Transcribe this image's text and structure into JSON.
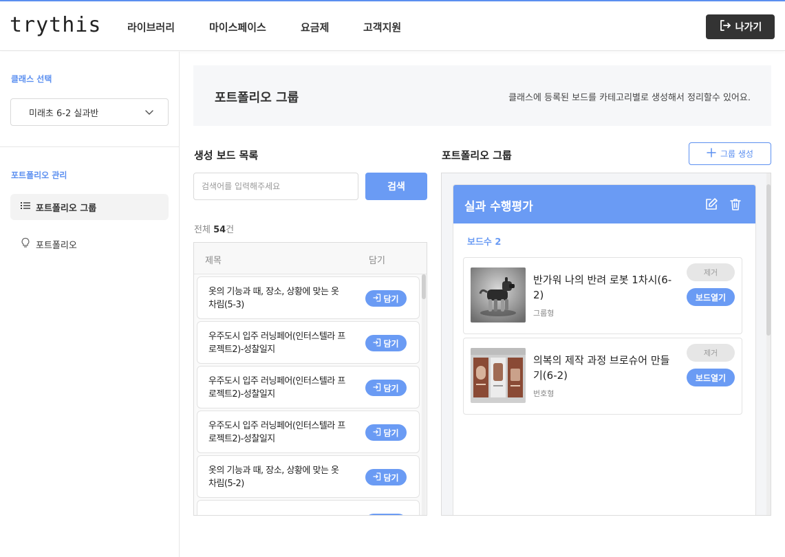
{
  "app": {
    "logo": "trythis",
    "accent": "#5b8ff0",
    "button_blue": "#6a9bf4"
  },
  "nav": {
    "items": [
      {
        "label": "라이브러리"
      },
      {
        "label": "마이스페이스"
      },
      {
        "label": "요금제"
      },
      {
        "label": "고객지원"
      }
    ],
    "exit_label": "나가기",
    "exit_icon": "logout-icon"
  },
  "sidebar": {
    "class_select_title": "클래스 선택",
    "class_selected": "미래초 6-2 실과반",
    "portfolio_title": "포트폴리오 관리",
    "menu": [
      {
        "label": "포트폴리오 그룹",
        "icon": "list-icon",
        "active": true
      },
      {
        "label": "포트폴리오",
        "icon": "lightbulb-icon",
        "active": false
      }
    ]
  },
  "banner": {
    "title": "포트폴리오 그룹",
    "description": "클래스에 등록된 보드를 카테고리별로 생성해서 정리할수 있어요."
  },
  "board_list": {
    "title": "생성 보드 목록",
    "search_placeholder": "검색어를 입력해주세요",
    "search_button": "검색",
    "total_prefix": "전체",
    "total_count": "54",
    "total_suffix": "건",
    "columns": {
      "title": "제목",
      "action": "담기"
    },
    "put_label": "담기",
    "items": [
      {
        "title": "옷의 기능과 때, 장소, 상황에 맞는 옷차림(5-3)"
      },
      {
        "title": "우주도시 입주 러닝페어(인터스텔라 프로젝트2)-성찰일지"
      },
      {
        "title": "우주도시 입주 러닝페어(인터스텔라 프로젝트2)-성찰일지"
      },
      {
        "title": "우주도시 입주 러닝페어(인터스텔라 프로젝트2)-성찰일지"
      },
      {
        "title": "옷의 기능과 때, 장소, 상황에 맞는 옷차림(5-2)"
      },
      {
        "title": ""
      }
    ]
  },
  "portfolio_groups": {
    "title": "포트폴리오 그룹",
    "add_button": "그룹 생성",
    "groups": [
      {
        "name": "실과 수행평가",
        "count_label": "보드수 2",
        "boards": [
          {
            "title": "반가워 나의 반려 로봇 1차시(6-2)",
            "type": "그룹형",
            "remove": "제거",
            "open": "보드열기",
            "thumb": "robot-dog-image"
          },
          {
            "title": "의복의 제작 과정 브로슈어 만들기(6-2)",
            "type": "번호형",
            "remove": "제거",
            "open": "보드열기",
            "thumb": "brochure-image"
          }
        ]
      }
    ]
  }
}
